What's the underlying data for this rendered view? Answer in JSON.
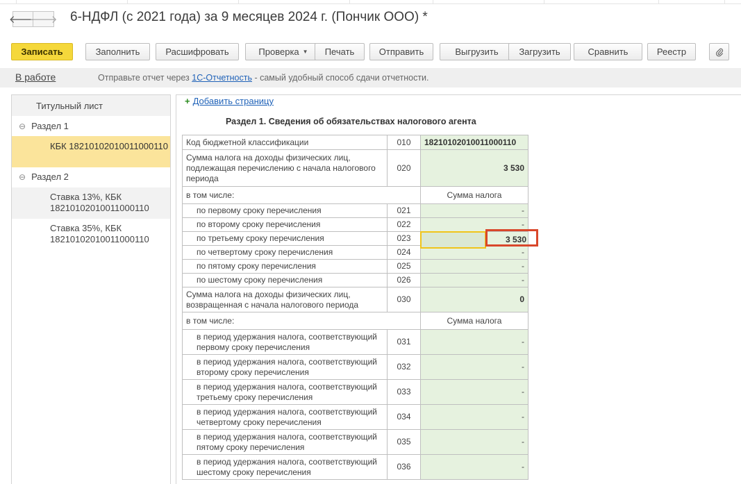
{
  "window": {
    "title": "6-НДФЛ (с 2021 года) за 9 месяцев 2024 г. (Пончик ООО) *",
    "back_icon": "arrow-left-icon",
    "forward_icon": "arrow-right-icon"
  },
  "toolbar": {
    "save": "Записать",
    "fill": "Заполнить",
    "decode": "Расшифровать",
    "check": "Проверка",
    "print": "Печать",
    "send": "Отправить",
    "export": "Выгрузить",
    "import": "Загрузить",
    "compare": "Сравнить",
    "registry": "Реестр",
    "attach_icon": "paperclip-icon"
  },
  "infobar": {
    "status": "В работе",
    "text_before": "Отправьте отчет через ",
    "link": "1С-Отчетность",
    "text_after": " - самый удобный способ сдачи отчетности."
  },
  "sidebar": {
    "title_page": "Титульный лист",
    "section1": "Раздел 1",
    "section1_item": "КБК 18210102010011000110",
    "section2": "Раздел 2",
    "rate13_line1": "Ставка 13%, КБК",
    "rate13_line2": "18210102010011000110",
    "rate35_line1": "Ставка 35%, КБК",
    "rate35_line2": "18210102010011000110",
    "collapse_icon": "collapse-circle-icon"
  },
  "content": {
    "add_page": "Добавить страницу",
    "section_title": "Раздел 1. Сведения об обязательствах налогового агента"
  },
  "form": {
    "r010_label": "Код бюджетной классификации",
    "r010_code": "010",
    "r010_value": "18210102010011000110",
    "r020_label": "Сумма налога на доходы физических лиц, подлежащая перечислению с начала налогового периода",
    "r020_code": "020",
    "r020_value": "3 530",
    "incl_label": "в том числе:",
    "tax_sum_header": "Сумма налога",
    "r021_label": "по первому сроку перечисления",
    "r021_code": "021",
    "r021_value": "-",
    "r022_label": "по второму сроку перечисления",
    "r022_code": "022",
    "r022_value": "-",
    "r023_label": "по третьему сроку перечисления",
    "r023_code": "023",
    "r023_value": "3 530",
    "r024_label": "по четвертому сроку перечисления",
    "r024_code": "024",
    "r024_value": "-",
    "r025_label": "по пятому сроку перечисления",
    "r025_code": "025",
    "r025_value": "-",
    "r026_label": "по шестому сроку перечисления",
    "r026_code": "026",
    "r026_value": "-",
    "r030_label": "Сумма налога на доходы физических лиц, возвращенная с начала налогового периода",
    "r030_code": "030",
    "r030_value": "0",
    "r031_label": "в период удержания налога, соответствующий первому сроку перечисления",
    "r031_code": "031",
    "r031_value": "-",
    "r032_label": "в период удержания налога, соответствующий второму сроку перечисления",
    "r032_code": "032",
    "r032_value": "-",
    "r033_label": "в период удержания налога, соответствующий третьему сроку перечисления",
    "r033_code": "033",
    "r033_value": "-",
    "r034_label": "в период удержания налога, соответствующий четвертому сроку перечисления",
    "r034_code": "034",
    "r034_value": "-",
    "r035_label": "в период удержания налога, соответствующий пятому сроку перечисления",
    "r035_code": "035",
    "r035_value": "-",
    "r036_label": "в период удержания налога, соответствующий шестому сроку перечисления",
    "r036_code": "036",
    "r036_value": "-"
  }
}
